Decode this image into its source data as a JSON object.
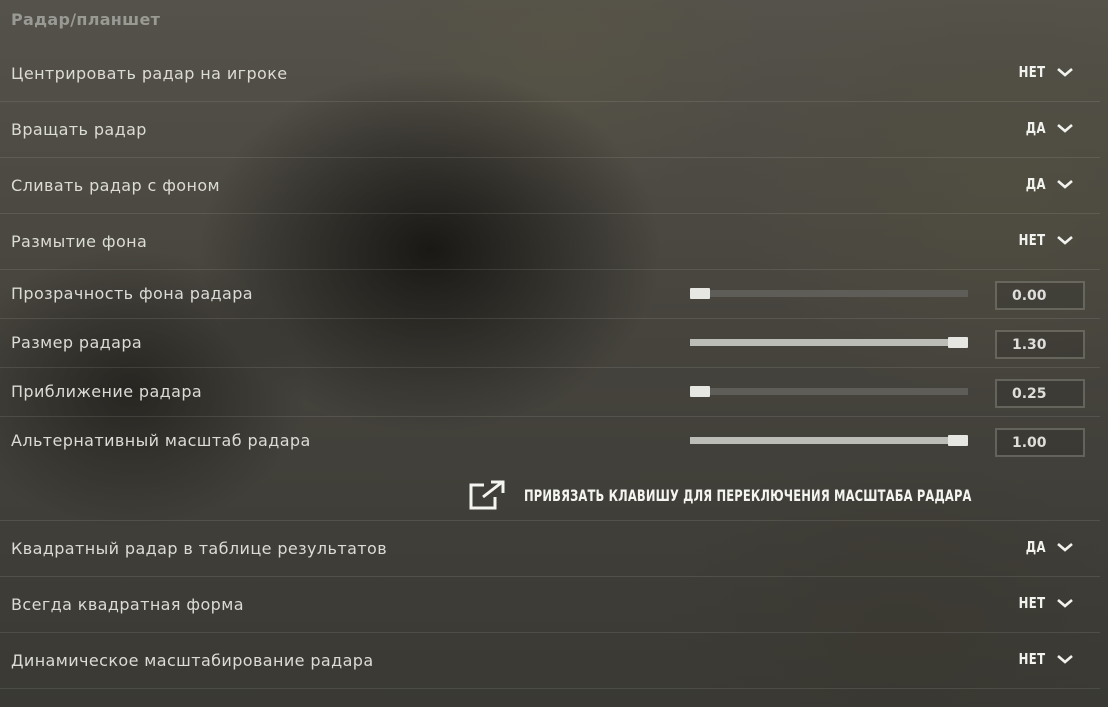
{
  "section": {
    "title": "Радар/планшет"
  },
  "toggles_top": [
    {
      "label": "Центрировать радар на игроке",
      "value": "НЕТ"
    },
    {
      "label": "Вращать радар",
      "value": "ДА"
    },
    {
      "label": "Сливать радар с фоном",
      "value": "ДА"
    },
    {
      "label": "Размытие фона",
      "value": "НЕТ"
    }
  ],
  "sliders": [
    {
      "label": "Прозрачность фона радара",
      "value": "0.00",
      "level": 0.0
    },
    {
      "label": "Размер радара",
      "value": "1.30",
      "level": 1.0
    },
    {
      "label": "Приближение радара",
      "value": "0.25",
      "level": 0.0
    },
    {
      "label": "Альтернативный масштаб радара",
      "value": "1.00",
      "level": 1.0
    }
  ],
  "bind_key": {
    "label": "ПРИВЯЗАТЬ КЛАВИШУ ДЛЯ ПЕРЕКЛЮЧЕНИЯ МАСШТАБА РАДАРА",
    "icon": "external-link-icon"
  },
  "toggles_bottom": [
    {
      "label": "Квадратный радар в таблице результатов",
      "value": "ДА"
    },
    {
      "label": "Всегда квадратная форма",
      "value": "НЕТ"
    },
    {
      "label": "Динамическое масштабирование радара",
      "value": "НЕТ"
    }
  ],
  "colors": {
    "text": "#dcdcd6",
    "value": "#f2f2ee",
    "track": "#5e5d58",
    "fill": "#bdbdb7",
    "handle": "#e6e6e2"
  }
}
